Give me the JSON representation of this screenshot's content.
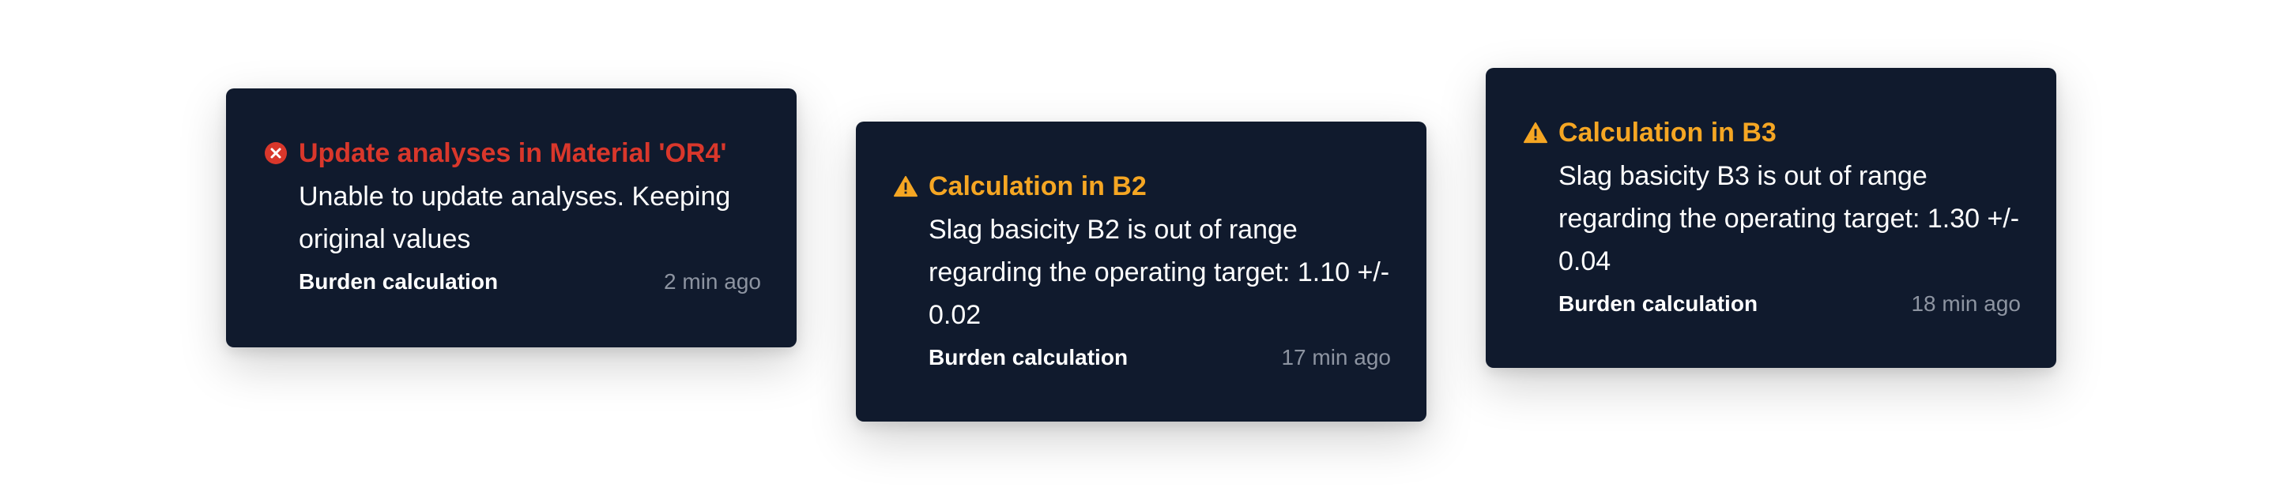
{
  "colors": {
    "background": "#ffffff",
    "toast_bg": "#101a2d",
    "error": "#d9372b",
    "warning": "#f5a623",
    "muted": "#8d94a1"
  },
  "notifications": [
    {
      "severity": "error",
      "icon": "error-circle-x-icon",
      "title": "Update analyses in Material 'OR4'",
      "message": "Unable to update analyses. Keeping original values",
      "source": "Burden calculation",
      "time": "2 min ago"
    },
    {
      "severity": "warning",
      "icon": "warning-triangle-icon",
      "title": "Calculation in B2",
      "message": "Slag basicity B2 is out of range regarding the operating target: 1.10 +/- 0.02",
      "source": "Burden calculation",
      "time": "17 min ago"
    },
    {
      "severity": "warning",
      "icon": "warning-triangle-icon",
      "title": "Calculation in B3",
      "message": "Slag basicity B3 is out of range regarding the operating target: 1.30 +/- 0.04",
      "source": "Burden calculation",
      "time": "18 min ago"
    }
  ]
}
